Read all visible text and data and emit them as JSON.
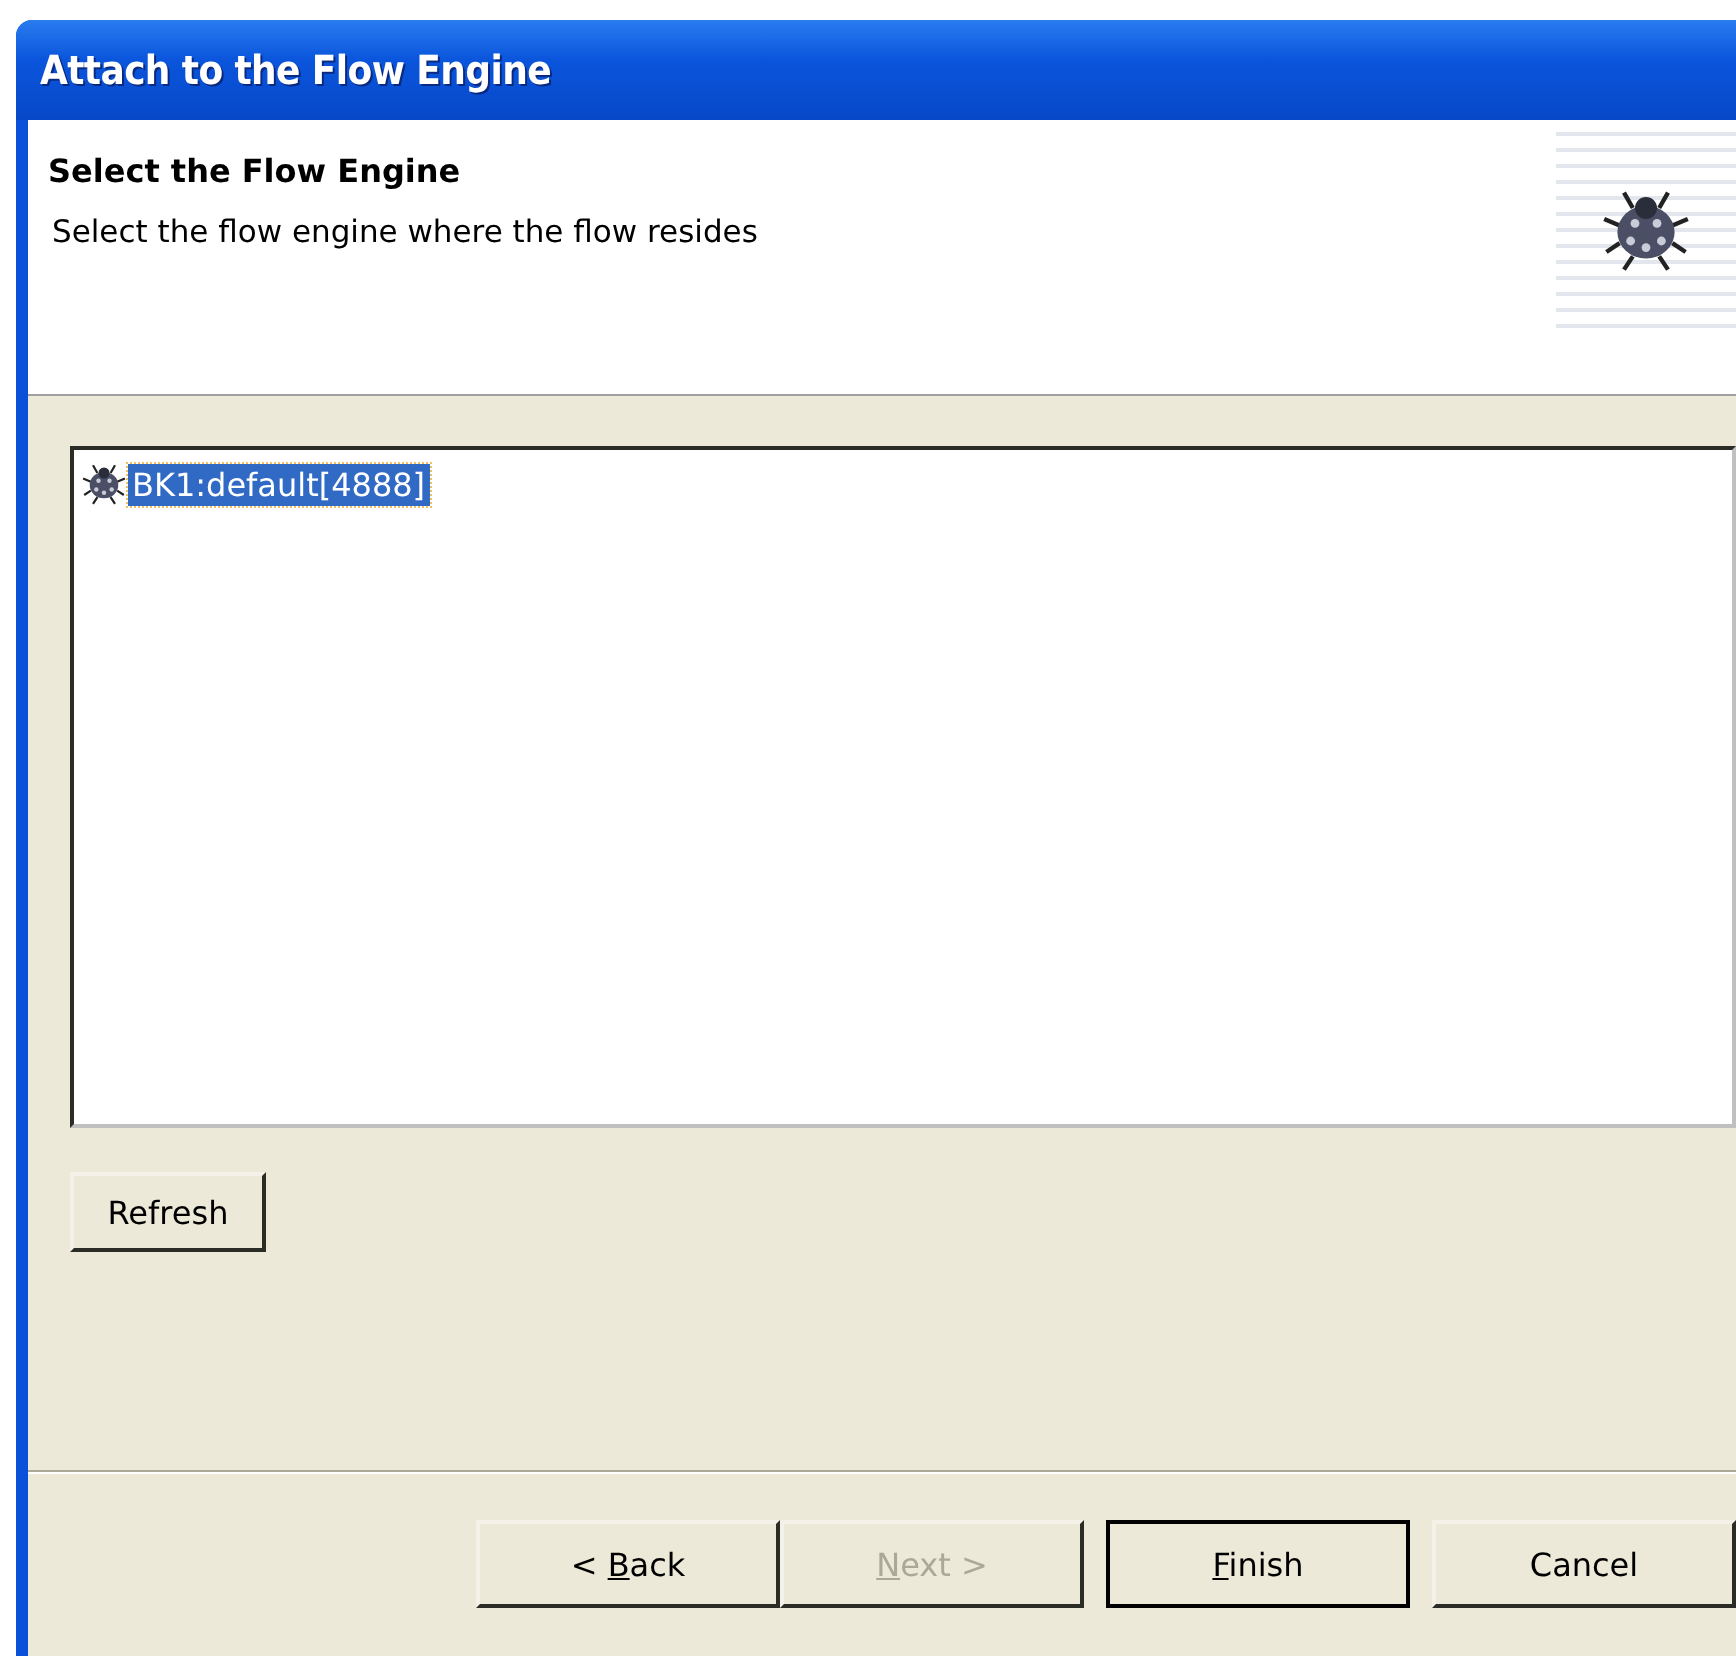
{
  "window": {
    "title": "Attach to the Flow Engine"
  },
  "header": {
    "title": "Select the Flow Engine",
    "description": "Select the flow engine where the flow resides"
  },
  "engines": [
    {
      "label": "BK1:default[4888]",
      "selected": true
    }
  ],
  "refresh_button": {
    "label": "Refresh"
  },
  "buttons": [
    {
      "label": {
        "before": "< ",
        "access_key": "B",
        "after": "ack"
      },
      "disabled": false,
      "default": false
    },
    {
      "label": {
        "access_key": "N",
        "after": "ext >"
      },
      "disabled": true,
      "default": false
    },
    {
      "label": {
        "access_key": "F",
        "after": "inish"
      },
      "disabled": false,
      "default": true
    },
    {
      "label": {
        "before": "Cancel"
      },
      "disabled": false,
      "default": false
    }
  ]
}
